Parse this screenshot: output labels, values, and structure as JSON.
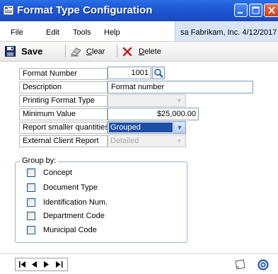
{
  "window": {
    "title": "Format Type Configuration",
    "icons": {
      "app": "window-app-icon",
      "minimize": "minimize-icon",
      "maximize": "maximize-icon",
      "close": "close-icon"
    }
  },
  "menu": {
    "items": [
      "File",
      "Edit",
      "Tools",
      "Help"
    ],
    "user_info": "sa  Fabrikam, Inc.  4/12/2017"
  },
  "toolbar": {
    "save_label": "Save",
    "clear_label_prefix": "",
    "clear_label_ul": "C",
    "clear_label_rest": "lear",
    "delete_label_ul": "D",
    "delete_label_rest": "elete"
  },
  "form": {
    "format_number": {
      "label": "Format Number",
      "value": "1001"
    },
    "description": {
      "label": "Description",
      "value": "Format number"
    },
    "printing_format_type": {
      "label": "Printing Format Type",
      "value": ""
    },
    "minimum_value": {
      "label": "Minimum Value",
      "value": "$25,000.00"
    },
    "report_smaller_quantities": {
      "label": "Report smaller quantities",
      "value": "Grouped"
    },
    "external_client_report": {
      "label": "External Client Report",
      "value": "Detailed"
    }
  },
  "group_by": {
    "title": "Group by:",
    "options": [
      {
        "label": "Concept",
        "checked": false
      },
      {
        "label": "Document Type",
        "checked": false
      },
      {
        "label": "Identification Num.",
        "checked": false
      },
      {
        "label": "Department Code",
        "checked": false
      },
      {
        "label": "Municipal Code",
        "checked": false
      }
    ]
  },
  "navigation": {
    "first": "first-record-icon",
    "prev": "previous-record-icon",
    "next": "next-record-icon",
    "last": "last-record-icon"
  },
  "colors": {
    "titlebar": "#1f58d6",
    "selected_dropdown": "#1f4ea6",
    "menubar_user": "#d8e4f8"
  }
}
